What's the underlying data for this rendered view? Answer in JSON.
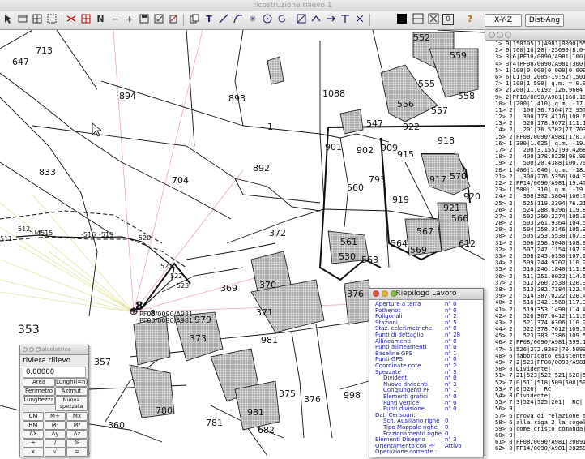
{
  "window": {
    "title": "ricostruzione rilievo 1"
  },
  "toolbar": {
    "icons": [
      "cursor-icon",
      "window-icon",
      "grid-icon",
      "select-icon",
      "move-icon",
      "lens-icon",
      "cross-icon",
      "rect-icon",
      "north-icon",
      "minus-icon",
      "plus-icon",
      "save-icon",
      "check-icon",
      "clipboard-icon",
      "copy-icon",
      "text-icon",
      "line-icon",
      "curve-icon",
      "star-icon",
      "circle-icon",
      "rotate-icon",
      "dimension-icon",
      "arrow-icon",
      "arrowright-icon",
      "tsquare-icon",
      "fill-icon",
      "splitv-icon",
      "splith-icon",
      "x-box-icon",
      "zero-box-icon",
      "help-icon"
    ],
    "xyz_label": "X-Y-Z",
    "distang_label": "Dist-Ang",
    "x_box": "X",
    "zero_box": "0",
    "text_tool": "T",
    "north": "N",
    "help": "?"
  },
  "map": {
    "parcels": [
      "894",
      "893",
      "1088",
      "552",
      "559",
      "556",
      "555",
      "557",
      "558",
      "547",
      "922",
      "915",
      "918",
      "917",
      "570",
      "833",
      "892",
      "704",
      "560",
      "793",
      "919",
      "921",
      "920",
      "566",
      "567",
      "569",
      "564",
      "612",
      "372",
      "561",
      "530",
      "563",
      "369",
      "370",
      "371",
      "376",
      "353",
      "981",
      "979",
      "357",
      "373",
      "375",
      "376",
      "998",
      "780",
      "981",
      "360",
      "682"
    ],
    "points": [
      "511",
      "512",
      "513",
      "514",
      "515",
      "516",
      "519",
      "520",
      "521",
      "522",
      "523"
    ],
    "station": "8",
    "station_tag": "PF08/0090/A981",
    "station_tag2": "PF08/0090/A981",
    "small_labels": [
      "56",
      "9",
      "8",
      "78",
      "50",
      "973",
      "1",
      "2",
      "4",
      "3",
      "68"
    ]
  },
  "list": {
    "rows": [
      "1> 0|150105|1|A981|0090|55",
      "2> 0|760|10|20|-25690|8.0-[",
      "3> 3|6|PF10/0090/A981|100|2",
      "4> 3|4|PF08/0090/A981|300|5",
      "5> 1|100|0.000|0.000|0.000|",
      "6> 6|L1|50|2005-19:52|1501",
      "7> 1|100|1.590| q.m. = 0.000",
      "8> 2|200|11.0192|126.9604",
      "9> 2|PF10/0090/A981|168.1804",
      "10> 1|200|1.410| q.m. -17.7",
      "11> 2|  100|36.7364|72.9574|",
      "12> 2|  300|173.4116|108.698",
      "13> 2|  520|178.9672|111.138",
      "14> 2|  201|76.5702|77.7030|",
      "15> 2|PF08/0090/A981|170.70",
      "16> 1|300|1.625| q.m. -19.4",
      "17> 2|  200|3.1552|99.4268|1",
      "18> 2|  400|178.8228|96.9034",
      "19> 2|  500|20.4388|100.7040",
      "20> 1|400|1.640| q.m. -18.1",
      "21> 2|  300|276.5356|104.338",
      "22> 2|PF14/0090/A981|19.472",
      "23> 1|500|1.310| q.m. -19.4",
      "24> 2|  300|302.3864|100.784",
      "25> 2|  525|119.3394|76.2124",
      "26> 2|  524|288.6396|119.847",
      "27> 2|  502|260.2274|105.022",
      "28> 2|  503|261.9364|104.584",
      "29> 2|  504|258.3146|105.301",
      "30> 2|  505|253.5530|107.339",
      "31> 2|  506|258.5040|108.052",
      "32> 2|  507|247.1154|107.000",
      "33> 2|  508|245.0130|107.273",
      "34> 2|  509|244.9702|110.221",
      "35> 2|  510|246.1840|111.875",
      "36> 2|  511|251.0022|114.507",
      "37> 2|  512|260.2530|120.306",
      "38> 2|  513|282.7184|122.437",
      "39> 2|  514|387.0222|120.425",
      "40> 2|  516|342.1560|117.309",
      "41> 2|  519|353.1490|114.445",
      "42> 2|  520|367.0412|111.692",
      "43> 2|  521|374.6306|110.255",
      "44> 2|  522|378.7012|109.766",
      "45> 2|  523|383.7386|109.552",
      "46> 2|PF08/0090/A981|399.13",
      "47> 5|526|272.8263|70.5099|",
      "48> 6|fabbricato esistente|",
      "49> 7|2|523|PF08/0090/A981",
      "50> 8|Dividente|",
      "51> 7|21|523|522|521|520|51",
      "52> 7|0|511|518|509|508|507",
      "53> 7|0|526|  RC|",
      "54> 8|Dividente|",
      "55> 7|3|524|525|201|  RC|",
      "56> 9|",
      "57> 6|prova di relazione te",
      "58> 6|alla riga 2 la sogel",
      "59> 6|come cristo comanda|",
      "60> 9|",
      "61> 0|PF08/0090/A981|20091.",
      "62> 0|PF14/0090/A981|28258."
    ]
  },
  "calculator": {
    "title": "Calcolatrice",
    "project": "riviera rilievo",
    "display": "0.00000",
    "buttons": [
      "Area",
      "Lungh(l=n)",
      "Perimetro",
      "Azimut",
      "Lunghezza",
      "Nuova spezzata",
      "CM",
      "M+",
      "Mx",
      "RM",
      "M-",
      "M/",
      "ΔX",
      "Δy",
      "Δz",
      "±",
      "/",
      "%",
      "+",
      "x",
      "=",
      "–",
      "√"
    ]
  },
  "riepilogo": {
    "title": "Riepilogo Lavoro",
    "rows": [
      {
        "label": "Aperture a terra",
        "value": "n° 0",
        "indent": false
      },
      {
        "label": "Pothenot",
        "value": "n° 0",
        "indent": false
      },
      {
        "label": "Poligonali",
        "value": "n° 2",
        "indent": false
      },
      {
        "label": "Stazioni",
        "value": "n° 5",
        "indent": false
      },
      {
        "label": "Staz. celerimetriche",
        "value": "n° 0",
        "indent": false
      },
      {
        "label": "Punti di dettaglio",
        "value": "n° 28",
        "indent": false
      },
      {
        "label": "Allineamenti",
        "value": "n° 0",
        "indent": false
      },
      {
        "label": "Punti allineamenti",
        "value": "n° 0",
        "indent": false
      },
      {
        "label": "Baseline GPS",
        "value": "n° 1",
        "indent": false
      },
      {
        "label": "Punti GPS",
        "value": "n° 0",
        "indent": false
      },
      {
        "label": "Coordinate note",
        "value": "n° 2",
        "indent": false
      },
      {
        "label": "Spezzate",
        "value": "n° 3",
        "indent": false
      },
      {
        "label": "Dividenti",
        "value": "n° 0",
        "indent": true
      },
      {
        "label": "Nuove dividenti",
        "value": "n° 3",
        "indent": true
      },
      {
        "label": "Congiungenti PF",
        "value": "n° 1",
        "indent": true
      },
      {
        "label": "Elementi grafici",
        "value": "n° 0",
        "indent": true
      },
      {
        "label": "Punti vertice",
        "value": "n° 0",
        "indent": true
      },
      {
        "label": "Punti divisione",
        "value": "n° 0",
        "indent": true
      },
      {
        "label": "Dati Censuari:",
        "value": "",
        "indent": false
      },
      {
        "label": "Sch. Ausiliario righe",
        "value": "0",
        "indent": true
      },
      {
        "label": "Tipo Mappale  righe",
        "value": "0",
        "indent": true
      },
      {
        "label": "Frazionamento  righe",
        "value": "0",
        "indent": true
      },
      {
        "label": "Elementi Disegno",
        "value": "n° 3",
        "indent": false
      },
      {
        "label": "Orientamento con PF",
        "value": "Attivo",
        "indent": false
      },
      {
        "label": "Operazione corrente :",
        "value": "",
        "indent": false
      }
    ]
  },
  "colors": {
    "row_text": "#2020a0",
    "hatch": "#8a8a8a",
    "trace": "#e6e6a8",
    "pink": "#e9a8d0"
  }
}
